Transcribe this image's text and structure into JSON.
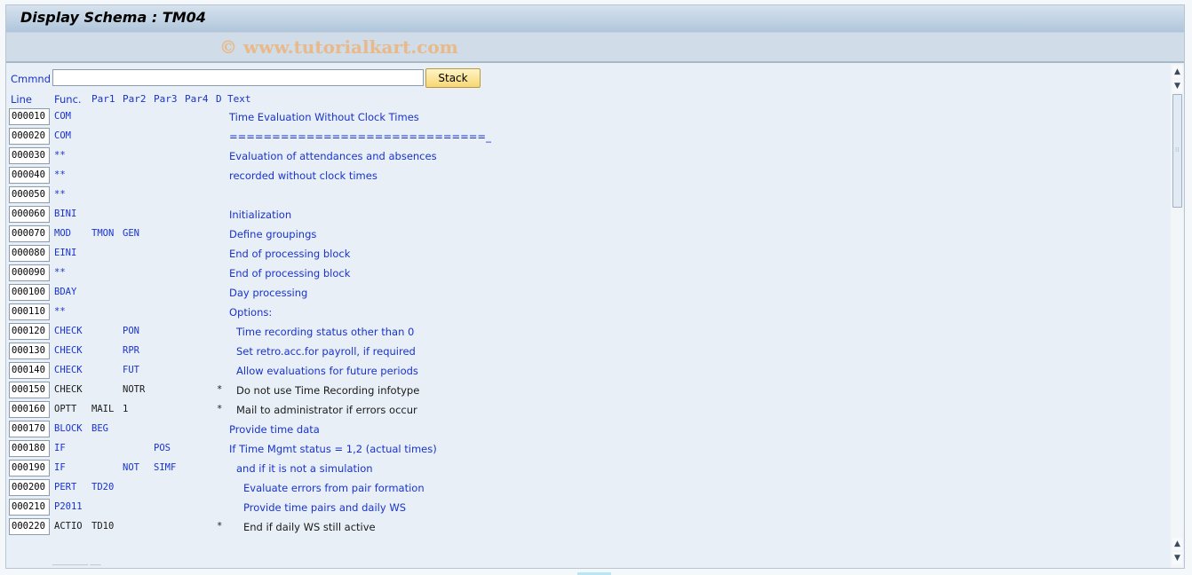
{
  "window": {
    "title": "Display Schema : TM04",
    "watermark": "© www.tutorialkart.com"
  },
  "command": {
    "label": "Cmmnd",
    "value": "",
    "stack_button": "Stack"
  },
  "columns": {
    "line": "Line",
    "func": "Func.",
    "par1": "Par1",
    "par2": "Par2",
    "par3": "Par3",
    "par4": "Par4",
    "d": "D",
    "text": "Text"
  },
  "rows": [
    {
      "line": "000010",
      "func": "COM",
      "par1": "",
      "par2": "",
      "par3": "",
      "d": "",
      "text": "Time Evaluation Without Clock Times",
      "indent": 0,
      "active": true
    },
    {
      "line": "000020",
      "func": "COM",
      "par1": "",
      "par2": "",
      "par3": "",
      "d": "",
      "text": "==============================_",
      "indent": 0,
      "active": true
    },
    {
      "line": "000030",
      "func": "**",
      "par1": "",
      "par2": "",
      "par3": "",
      "d": "",
      "text": "Evaluation of attendances and absences",
      "indent": 0,
      "active": true
    },
    {
      "line": "000040",
      "func": "**",
      "par1": "",
      "par2": "",
      "par3": "",
      "d": "",
      "text": "recorded without clock times",
      "indent": 0,
      "active": true
    },
    {
      "line": "000050",
      "func": "**",
      "par1": "",
      "par2": "",
      "par3": "",
      "d": "",
      "text": "",
      "indent": 0,
      "active": true
    },
    {
      "line": "000060",
      "func": "BINI",
      "par1": "",
      "par2": "",
      "par3": "",
      "d": "",
      "text": "Initialization",
      "indent": 0,
      "active": true
    },
    {
      "line": "000070",
      "func": "MOD",
      "par1": "TMON",
      "par2": "GEN",
      "par3": "",
      "d": "",
      "text": "Define groupings",
      "indent": 0,
      "active": true
    },
    {
      "line": "000080",
      "func": "EINI",
      "par1": "",
      "par2": "",
      "par3": "",
      "d": "",
      "text": "End of processing block",
      "indent": 0,
      "active": true
    },
    {
      "line": "000090",
      "func": "**",
      "par1": "",
      "par2": "",
      "par3": "",
      "d": "",
      "text": "End of processing block",
      "indent": 0,
      "active": true
    },
    {
      "line": "000100",
      "func": "BDAY",
      "par1": "",
      "par2": "",
      "par3": "",
      "d": "",
      "text": "Day processing",
      "indent": 0,
      "active": true
    },
    {
      "line": "000110",
      "func": "**",
      "par1": "",
      "par2": "",
      "par3": "",
      "d": "",
      "text": "Options:",
      "indent": 0,
      "active": true
    },
    {
      "line": "000120",
      "func": "CHECK",
      "par1": "",
      "par2": "PON",
      "par3": "",
      "d": "",
      "text": "Time recording status other than 0",
      "indent": 1,
      "active": true
    },
    {
      "line": "000130",
      "func": "CHECK",
      "par1": "",
      "par2": "RPR",
      "par3": "",
      "d": "",
      "text": "Set retro.acc.for payroll, if required",
      "indent": 1,
      "active": true
    },
    {
      "line": "000140",
      "func": "CHECK",
      "par1": "",
      "par2": "FUT",
      "par3": "",
      "d": "",
      "text": "Allow evaluations for future periods",
      "indent": 1,
      "active": true
    },
    {
      "line": "000150",
      "func": "CHECK",
      "par1": "",
      "par2": "NOTR",
      "par3": "",
      "d": "*",
      "text": "Do not use Time Recording infotype",
      "indent": 1,
      "active": false
    },
    {
      "line": "000160",
      "func": "OPTT",
      "par1": "MAIL",
      "par2": "1",
      "par3": "",
      "d": "*",
      "text": "Mail to administrator if errors occur",
      "indent": 1,
      "active": false
    },
    {
      "line": "000170",
      "func": "BLOCK",
      "par1": "BEG",
      "par2": "",
      "par3": "",
      "d": "",
      "text": "Provide time data",
      "indent": 0,
      "active": true
    },
    {
      "line": "000180",
      "func": "IF",
      "par1": "",
      "par2": "",
      "par3": "POS",
      "d": "",
      "text": "If Time Mgmt status = 1,2 (actual times)",
      "indent": 0,
      "active": true
    },
    {
      "line": "000190",
      "func": "IF",
      "par1": "",
      "par2": "NOT",
      "par3": "SIMF",
      "d": "",
      "text": "and if it is not a simulation",
      "indent": 1,
      "active": true
    },
    {
      "line": "000200",
      "func": "PERT",
      "par1": "TD20",
      "par2": "",
      "par3": "",
      "d": "",
      "text": "Evaluate errors from pair formation",
      "indent": 2,
      "active": true
    },
    {
      "line": "000210",
      "func": "P2011",
      "par1": "",
      "par2": "",
      "par3": "",
      "d": "",
      "text": "Provide time pairs and daily WS",
      "indent": 2,
      "active": true
    },
    {
      "line": "000220",
      "func": "ACTIO",
      "par1": "TD10",
      "par2": "",
      "par3": "",
      "d": "*",
      "text": "End if daily WS still active",
      "indent": 2,
      "active": false
    }
  ],
  "footer": {
    "blank_line_placeholder": "__________  ___"
  },
  "colors": {
    "active_text": "#1a33cc",
    "inactive_text": "#1a1a1a",
    "stack_button": "#f7d774"
  }
}
